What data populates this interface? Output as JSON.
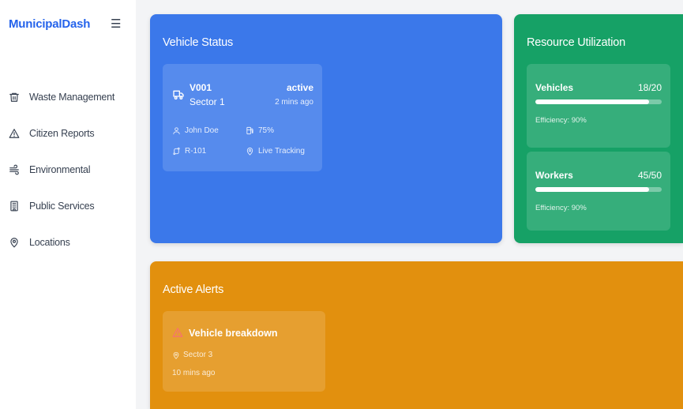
{
  "app": {
    "brand": "MunicipalDash",
    "menu_icon": "hamburger-icon"
  },
  "sidebar": {
    "items": [
      {
        "label": "Waste Management",
        "icon": "trash-icon"
      },
      {
        "label": "Citizen Reports",
        "icon": "alert-triangle-icon"
      },
      {
        "label": "Environmental",
        "icon": "wind-icon"
      },
      {
        "label": "Public Services",
        "icon": "building-icon"
      },
      {
        "label": "Locations",
        "icon": "map-pin-icon"
      }
    ]
  },
  "vehicle_status": {
    "title": "Vehicle Status",
    "vehicle": {
      "id": "V001",
      "sector": "Sector 1",
      "status": "active",
      "updated": "2 mins ago",
      "driver": "John Doe",
      "fuel": "75%",
      "route": "R-101",
      "tracking": "Live Tracking"
    }
  },
  "resource_utilization": {
    "title": "Resource Utilization",
    "resources": [
      {
        "name": "Vehicles",
        "count": "18/20",
        "fill_fraction": 0.9,
        "efficiency": "Efficiency: 90%"
      },
      {
        "name": "Workers",
        "count": "45/50",
        "fill_fraction": 0.9,
        "efficiency": "Efficiency: 90%"
      }
    ]
  },
  "active_alerts": {
    "title": "Active Alerts",
    "alerts": [
      {
        "title": "Vehicle breakdown",
        "location": "Sector 3",
        "time": "10 mins ago"
      }
    ]
  },
  "colors": {
    "brand": "#2563eb",
    "vehicle_card": "#3b78ea",
    "resource_card": "#16a166",
    "alerts_card": "#e2900e",
    "alert_icon": "#f87171"
  }
}
